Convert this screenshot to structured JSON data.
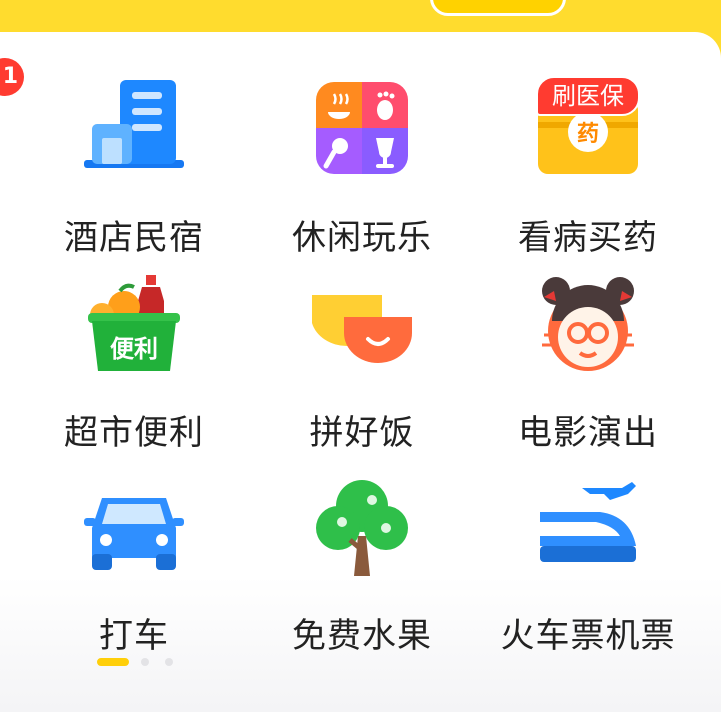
{
  "corner_badge": "1",
  "grid": {
    "items": [
      {
        "label": "酒店民宿",
        "icon": "hotel-building-icon"
      },
      {
        "label": "休闲玩乐",
        "icon": "leisure-fun-icon"
      },
      {
        "label": "看病买药",
        "icon": "medicine-box-icon",
        "tag": "刷医保",
        "icon_text": "药"
      },
      {
        "label": "超市便利",
        "icon": "grocery-basket-icon",
        "icon_text": "便利"
      },
      {
        "label": "拼好饭",
        "icon": "smiling-bowl-icon"
      },
      {
        "label": "电影演出",
        "icon": "movie-girl-icon"
      },
      {
        "label": "打车",
        "icon": "taxi-car-icon"
      },
      {
        "label": "免费水果",
        "icon": "fruit-tree-icon"
      },
      {
        "label": "火车票机票",
        "icon": "train-plane-icon"
      }
    ]
  },
  "pager": {
    "pages": 3,
    "active": 0
  },
  "colors": {
    "brand_yellow": "#ffdc2e",
    "badge_red": "#ff3b30",
    "icon_blue": "#1e88ff"
  }
}
